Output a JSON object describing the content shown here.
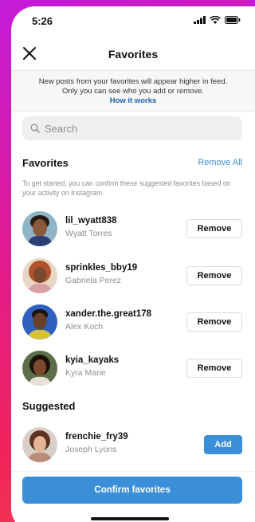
{
  "status": {
    "time": "5:26"
  },
  "header": {
    "title": "Favorites"
  },
  "info": {
    "line1": "New posts from your favorites will appear higher in feed.",
    "line2": "Only you can see who you add or remove.",
    "link": "How it works"
  },
  "search": {
    "placeholder": "Search"
  },
  "favorites": {
    "title": "Favorites",
    "remove_all": "Remove All",
    "hint": "To get started, you can confirm these suggested favorites based on your activity on Instagram.",
    "users": [
      {
        "username": "lil_wyatt838",
        "name": "Wyatt Torres",
        "action": "Remove"
      },
      {
        "username": "sprinkles_bby19",
        "name": "Gabriela Perez",
        "action": "Remove"
      },
      {
        "username": "xander.the.great178",
        "name": "Alex Koch",
        "action": "Remove"
      },
      {
        "username": "kyia_kayaks",
        "name": "Kyra Marie",
        "action": "Remove"
      }
    ]
  },
  "suggested": {
    "title": "Suggested",
    "users": [
      {
        "username": "frenchie_fry39",
        "name": "Joseph Lyons",
        "action": "Add"
      }
    ]
  },
  "footer": {
    "confirm": "Confirm favorites"
  },
  "colors": {
    "accent": "#3b8fd8",
    "link": "#1a5fa8",
    "muted": "#8e8e8e"
  }
}
